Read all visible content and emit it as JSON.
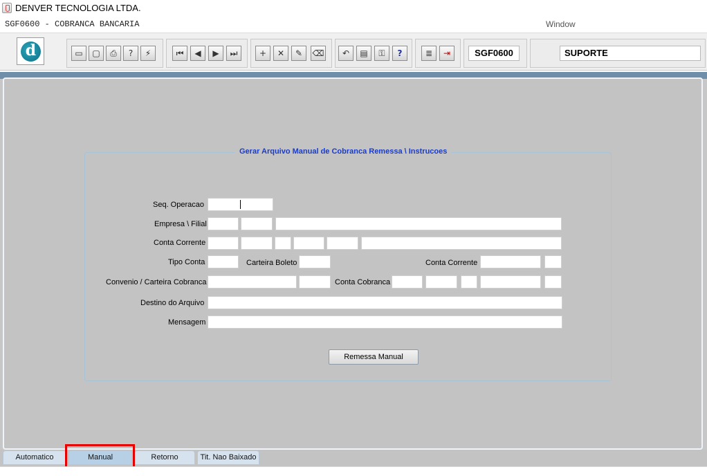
{
  "window": {
    "app_title": "DENVER TECNOLOGIA LTDA.",
    "form_title": "SGF0600 - COBRANCA BANCARIA",
    "window_menu": "Window"
  },
  "toolbar": {
    "icons": [
      "save-icon",
      "print-preview-icon",
      "print-icon",
      "help-query-icon",
      "execute-query-icon",
      "first-record-icon",
      "previous-record-icon",
      "next-record-icon",
      "last-record-icon",
      "insert-record-icon",
      "delete-record-icon",
      "edit-record-icon",
      "clear-record-icon",
      "undo-icon",
      "list-values-icon",
      "key-icon",
      "help-icon",
      "menu-icon",
      "exit-icon"
    ],
    "glyphs": [
      "▭",
      "▢",
      "⎙",
      "?",
      "⚡",
      "⏮",
      "◀",
      "▶",
      "⏭",
      "+",
      "✕",
      "✎",
      "⌫",
      "↶",
      "▤",
      "⚿",
      "?",
      "≣",
      "⇥"
    ],
    "form_code": "SGF0600",
    "user": "SUPORTE"
  },
  "form": {
    "frame_title": "Gerar Arquivo Manual de Cobranca Remessa \\ Instrucoes",
    "labels": {
      "seq_operacao": "Seq. Operacao",
      "empresa_filial": "Empresa \\ Filial",
      "conta_corrente": "Conta Corrente",
      "tipo_conta": "Tipo Conta",
      "carteira_boleto": "Carteira Boleto",
      "conta_corrente_2": "Conta Corrente",
      "convenio": "Convenio / Carteira Cobranca",
      "conta_cobranca": "Conta Cobranca",
      "destino": "Destino do Arquivo",
      "mensagem": "Mensagem"
    },
    "values": {
      "seq_operacao": "",
      "destino": "",
      "mensagem": ""
    },
    "remessa_button": "Remessa Manual"
  },
  "tabs": [
    {
      "label": "Automatico",
      "active": false
    },
    {
      "label": "Manual",
      "active": true
    },
    {
      "label": "Retorno",
      "active": false
    },
    {
      "label": "Tit. Nao Baixado",
      "active": false
    }
  ],
  "colors": {
    "frame_title": "#1a3cc8",
    "highlight": "#e60000",
    "canvas": "#c3c3c3"
  }
}
